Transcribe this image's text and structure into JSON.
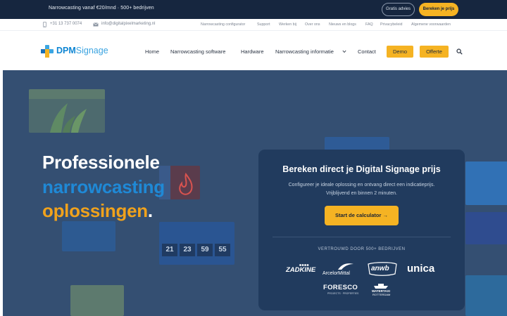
{
  "promo": {
    "text": "Narrowcasting vanaf €20/mnd · 500+ bedrijven",
    "advice_button": "Gratis advies",
    "price_button": "Bereken je prijs"
  },
  "utility": {
    "phone": "+31 13 737 0074",
    "email": "info@digitalpixelmarketing.nl",
    "links": [
      "Narrowcasting configurator",
      "Support",
      "Werken bij",
      "Over ons",
      "Nieuws en blogs",
      "FAQ",
      "Privacybeleid",
      "Algemene voorwaarden"
    ]
  },
  "logo": {
    "part1": "DPM",
    "part2": "Signage"
  },
  "nav": {
    "home": "Home",
    "software": "Narrowcasting software",
    "hardware": "Hardware",
    "info": "Narrowcasting informatie",
    "contact": "Contact",
    "demo": "Demo",
    "offer": "Offerte"
  },
  "hero": {
    "line1": "Professionele",
    "line2": "narrowcasting",
    "line3": "oplossingen",
    "dot": ".",
    "counter": [
      "21",
      "23",
      "59",
      "55"
    ],
    "colors": {
      "background": "#344f72",
      "blue": "#1f89d6",
      "orange": "#f0a21c"
    }
  },
  "card": {
    "title": "Bereken direct je Digital Signage prijs",
    "subtitle_1": "Configureer je ideale oplossing en ontvang direct een indicatieprijs.",
    "subtitle_2": "Vrijblijvend en binnen 2 minuten.",
    "cta": "Start de calculator →",
    "trust": "VERTROUWD DOOR 500+ BEDRIJVEN",
    "clients": {
      "zadkine": "ZADKINE",
      "arcelor": "ArcelorMittal",
      "anwb": "anwb",
      "unica": "unica",
      "foresco": "FORESCO",
      "foresco_sub": "PROJECTS · PROPERTIES",
      "watertaxi_1": "WATERTAXI",
      "watertaxi_2": "ROTTERDAM"
    }
  },
  "accent": "#f5b323"
}
